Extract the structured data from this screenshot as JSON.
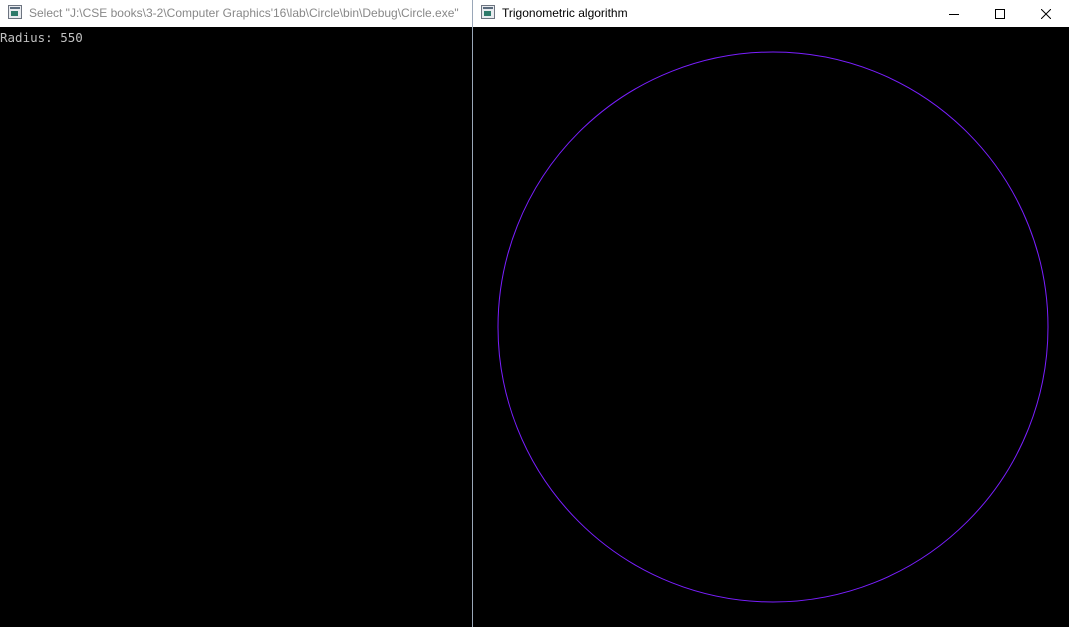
{
  "console_window": {
    "title": "Select \"J:\\CSE books\\3-2\\Computer Graphics'16\\lab\\Circle\\bin\\Debug\\Circle.exe\"",
    "icon": "console-app-icon",
    "output_line": "Radius: 550"
  },
  "graphics_window": {
    "title": "Trigonometric algorithm",
    "icon": "console-app-icon",
    "buttons": {
      "minimize": "minimize-icon",
      "maximize": "maximize-icon",
      "close": "close-icon"
    },
    "drawing": {
      "shape": "circle",
      "radius": 550,
      "stroke_color": "#7a1fff",
      "background": "#000000"
    }
  }
}
